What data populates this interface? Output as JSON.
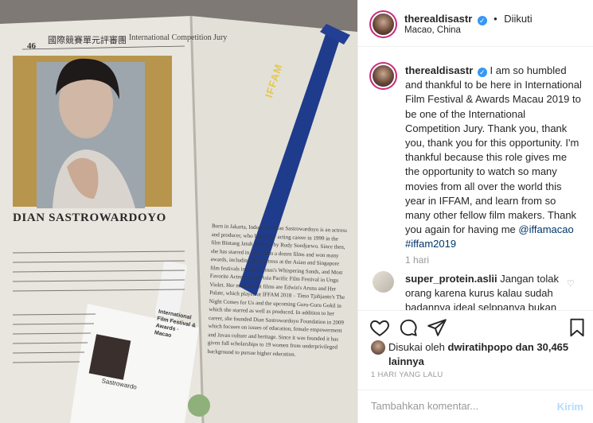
{
  "post": {
    "username": "therealdisastr",
    "follow_status": "Diikuti",
    "location": "Macao, China",
    "caption": "I am so humbled and thankful to be here in International Film Festival & Awards Macau 2019 to be one of the International Competition Jury. Thank you, thank you, thank you for this opportunity. I'm thankful because this role gives me the opportunity to watch so many movies from all over the world this year in IFFAM, and learn from so many other fellow film makers. Thank you again for having me",
    "mention": "@iffamacao",
    "hashtag": "#iffam2019",
    "caption_age": "1 hari",
    "comment": {
      "username": "super_protein.aslii",
      "text": "Jangan tolak orang karena kurus kalau sudah badannya ideal selppanya bukan"
    },
    "likes_text": "Disukai oleh dwiratihpopo dan 30,465 lainnya",
    "likes_user": "dwiratihpopo",
    "likes_rest": " dan 30,465 lainnya",
    "likes_prefix": "Disukai oleh ",
    "posted_ago": "1 HARI YANG LALU",
    "comment_placeholder": "Tambahkan komentar...",
    "post_button": "Kirim"
  },
  "photo": {
    "page_number": "46",
    "header_zh": "國際競賽單元評審團",
    "header_en": "International Competition Jury",
    "jury_name": "DIAN SASTROWARDOYO",
    "lanyard_brand": "IFFAM",
    "badge_title": "International Film Festival & Awards · Macao",
    "badge_name": "Dian Sastrowardo",
    "right_column_text": "Born in Jakarta, Indonesia, Dian Sastrowardoyo is an actress and producer, who began her acting career in 1999 in the film Bintang Jatuh directed by Rudy Soedjarwo. Since then, she has starred in more than a dozen films and won many awards, including Best actress at the Asian and Singapore film festivals in Nan Achnas's Whispering Sands, and Most Favorite Actress at the Asia Pacific Film Festival in Ungu Violet. Her most recent films are Edwin's Aruna and Her Palate, which played at IFFAM 2018 – Timo Tjahjanto's The Night Comes for Us and the upcoming Guru-Guru Gokil in which she starred as well as produced. In addition to her career, she founded Dian Sastrowardoyo Foundation in 2009 which focuses on issues of education, female empowerment and Javan culture and heritage. Since it was founded it has given full scholarships to 19 women from underprivileged background to pursue higher education."
  },
  "colors": {
    "accent_blue": "#3897f0",
    "link_blue": "#003569",
    "lanyard_blue": "#1f3b8c",
    "story_ring": "#c82a7c"
  }
}
